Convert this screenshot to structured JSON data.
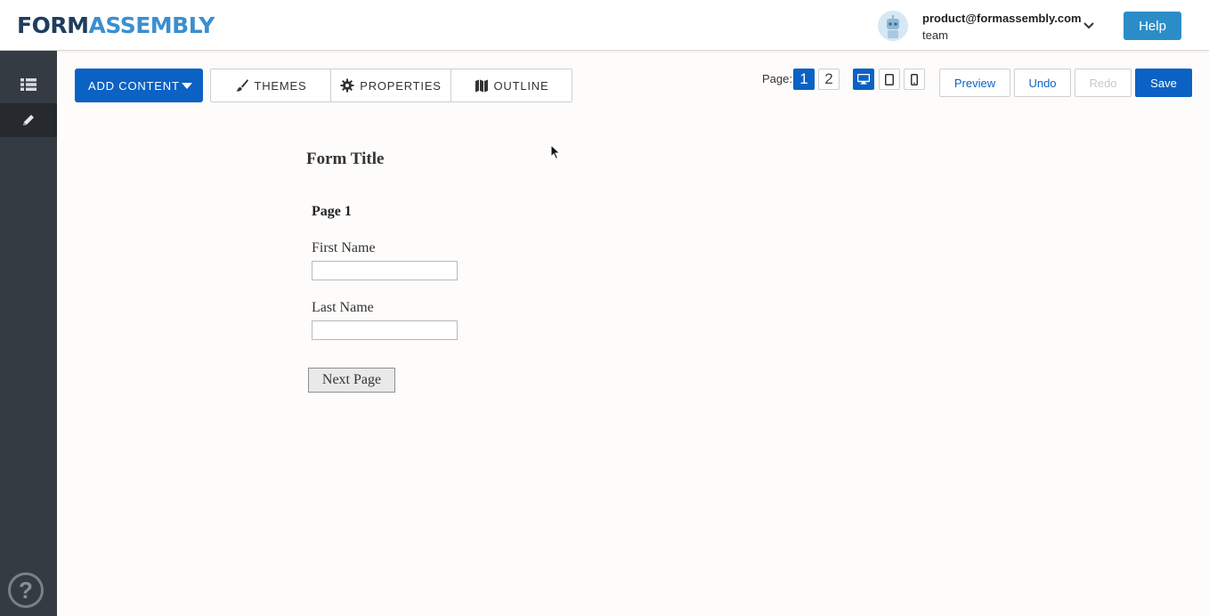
{
  "header": {
    "logo_form": "FORM",
    "logo_assembly": "ASSEMBLY",
    "user_email": "product@formassembly.com",
    "user_team": "team",
    "help_label": "Help"
  },
  "sidebar": {
    "items": [
      {
        "icon": "list-icon"
      },
      {
        "icon": "pencil-icon",
        "active": true
      }
    ],
    "help_glyph": "?"
  },
  "toolbar": {
    "add_content_label": "ADD CONTENT",
    "tabs": [
      {
        "label": "THEMES",
        "icon": "paintbrush-icon"
      },
      {
        "label": "PROPERTIES",
        "icon": "gear-icon"
      },
      {
        "label": "OUTLINE",
        "icon": "map-icon"
      }
    ],
    "page_label": "Page:",
    "pages": [
      "1",
      "2"
    ],
    "active_page": "1",
    "views": [
      "desktop-icon",
      "tablet-icon",
      "mobile-icon"
    ],
    "active_view": "desktop-icon",
    "preview_label": "Preview",
    "undo_label": "Undo",
    "redo_label": "Redo",
    "save_label": "Save"
  },
  "form": {
    "title": "Form Title",
    "page_heading": "Page 1",
    "fields": [
      {
        "label": "First Name",
        "value": ""
      },
      {
        "label": "Last Name",
        "value": ""
      }
    ],
    "next_label": "Next Page"
  },
  "colors": {
    "primary": "#0b62c4",
    "help": "#2b8dc8",
    "sidebar": "#353b43",
    "logo_dark": "#1f3d5c",
    "logo_light": "#3a8fd0"
  }
}
